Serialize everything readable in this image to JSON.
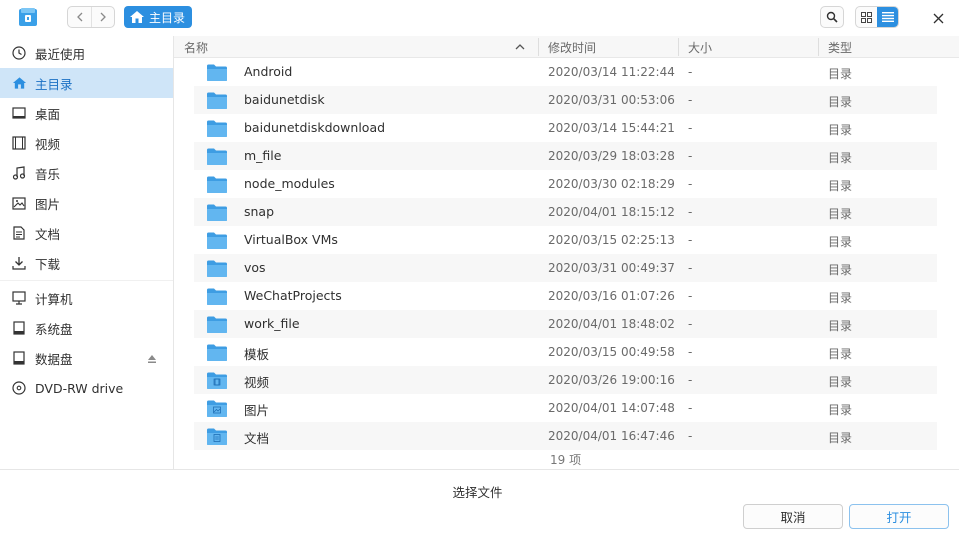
{
  "titlebar": {
    "breadcrumb": "主目录"
  },
  "sidebar": {
    "items": [
      {
        "label": "最近使用",
        "icon": "clock-icon"
      },
      {
        "label": "主目录",
        "icon": "home-icon",
        "active": true
      },
      {
        "label": "桌面",
        "icon": "desktop-icon"
      },
      {
        "label": "视频",
        "icon": "video-icon"
      },
      {
        "label": "音乐",
        "icon": "music-icon"
      },
      {
        "label": "图片",
        "icon": "image-icon"
      },
      {
        "label": "文档",
        "icon": "document-icon"
      },
      {
        "label": "下载",
        "icon": "download-icon"
      },
      {
        "label": "计算机",
        "icon": "computer-icon"
      },
      {
        "label": "系统盘",
        "icon": "drive-icon"
      },
      {
        "label": "数据盘",
        "icon": "drive-icon"
      },
      {
        "label": "DVD-RW drive",
        "icon": "disc-icon"
      }
    ]
  },
  "columns": {
    "name": "名称",
    "modified": "修改时间",
    "size": "大小",
    "type": "类型"
  },
  "files": [
    {
      "name": "Android",
      "modified": "2020/03/14 11:22:44",
      "size": "-",
      "type": "目录",
      "icon": "folder-icon"
    },
    {
      "name": "baidunetdisk",
      "modified": "2020/03/31 00:53:06",
      "size": "-",
      "type": "目录",
      "icon": "folder-icon"
    },
    {
      "name": "baidunetdiskdownload",
      "modified": "2020/03/14 15:44:21",
      "size": "-",
      "type": "目录",
      "icon": "folder-icon"
    },
    {
      "name": "m_file",
      "modified": "2020/03/29 18:03:28",
      "size": "-",
      "type": "目录",
      "icon": "folder-icon"
    },
    {
      "name": "node_modules",
      "modified": "2020/03/30 02:18:29",
      "size": "-",
      "type": "目录",
      "icon": "folder-icon"
    },
    {
      "name": "snap",
      "modified": "2020/04/01 18:15:12",
      "size": "-",
      "type": "目录",
      "icon": "folder-icon"
    },
    {
      "name": "VirtualBox VMs",
      "modified": "2020/03/15 02:25:13",
      "size": "-",
      "type": "目录",
      "icon": "folder-icon"
    },
    {
      "name": "vos",
      "modified": "2020/03/31 00:49:37",
      "size": "-",
      "type": "目录",
      "icon": "folder-icon"
    },
    {
      "name": "WeChatProjects",
      "modified": "2020/03/16 01:07:26",
      "size": "-",
      "type": "目录",
      "icon": "folder-icon"
    },
    {
      "name": "work_file",
      "modified": "2020/04/01 18:48:02",
      "size": "-",
      "type": "目录",
      "icon": "folder-icon"
    },
    {
      "name": "模板",
      "modified": "2020/03/15 00:49:58",
      "size": "-",
      "type": "目录",
      "icon": "folder-icon"
    },
    {
      "name": "视频",
      "modified": "2020/03/26 19:00:16",
      "size": "-",
      "type": "目录",
      "icon": "video-folder-icon"
    },
    {
      "name": "图片",
      "modified": "2020/04/01 14:07:48",
      "size": "-",
      "type": "目录",
      "icon": "image-folder-icon"
    },
    {
      "name": "文档",
      "modified": "2020/04/01 16:47:46",
      "size": "-",
      "type": "目录",
      "icon": "document-folder-icon"
    }
  ],
  "status": {
    "item_count": "19 项"
  },
  "dialog": {
    "title": "选择文件",
    "cancel_label": "取消",
    "open_label": "打开"
  },
  "colors": {
    "accent": "#2c8fe0",
    "folder": "#5eb3ee",
    "selected_bg": "#cfe5f8"
  }
}
